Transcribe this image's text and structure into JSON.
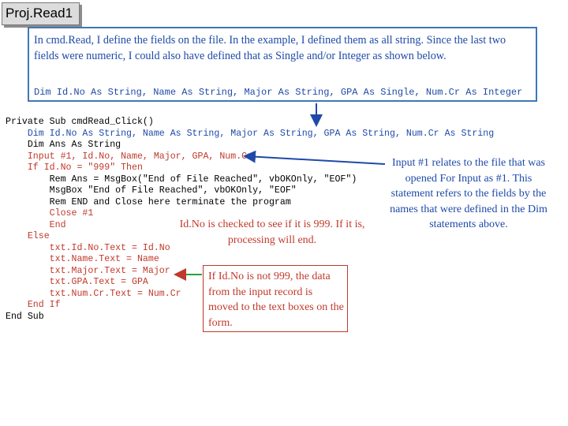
{
  "title": "Proj.Read1",
  "intro": {
    "text": "In cmd.Read, I define the fields on the file.  In the example, I defined them as all string.  Since the last two fields were numeric, I could also have defined that as Single and/or Integer as shown below.",
    "dim_line": "Dim Id.No As String, Name As String, Major As String, GPA As Single, Num.Cr As Integer"
  },
  "code": [
    {
      "text": "Private Sub cmdRead_Click()",
      "color": "black"
    },
    {
      "text": "    Dim Id.No As String, Name As String, Major As String, GPA As String, Num.Cr As String",
      "color": "blue"
    },
    {
      "text": "    Dim Ans As String",
      "color": "black"
    },
    {
      "text": "    Input #1, Id.No, Name, Major, GPA, Num.Cr",
      "color": "red"
    },
    {
      "text": "    If Id.No = \"999\" Then",
      "color": "red"
    },
    {
      "text": "        Rem Ans = MsgBox(\"End of File Reached\", vbOKOnly, \"EOF\")",
      "color": "black"
    },
    {
      "text": "        MsgBox \"End of File Reached\", vbOKOnly, \"EOF\"",
      "color": "black"
    },
    {
      "text": "        Rem END and Close here terminate the program",
      "color": "black"
    },
    {
      "text": "        Close #1",
      "color": "red"
    },
    {
      "text": "        End",
      "color": "red"
    },
    {
      "text": "    Else",
      "color": "red"
    },
    {
      "text": "        txt.Id.No.Text = Id.No",
      "color": "red"
    },
    {
      "text": "        txt.Name.Text = Name",
      "color": "red"
    },
    {
      "text": "        txt.Major.Text = Major",
      "color": "red"
    },
    {
      "text": "        txt.GPA.Text = GPA",
      "color": "red"
    },
    {
      "text": "        txt.Num.Cr.Text = Num.Cr",
      "color": "red"
    },
    {
      "text": "    End If",
      "color": "red"
    },
    {
      "text": "End Sub",
      "color": "black"
    }
  ],
  "notes": {
    "input": "Input #1 relates to the file that was opened For Input as #1. This statement refers to the fields by the names that were defined in the Dim statements above.",
    "check": "Id.No is checked to see if it is 999. If it is, processing will end.",
    "else": "If Id.No is not 999, the data from the input record is moved to the text boxes on the form."
  },
  "colors": {
    "blue": "#1f4aa8",
    "red": "#c0392b",
    "box_border": "#3f77b6"
  }
}
